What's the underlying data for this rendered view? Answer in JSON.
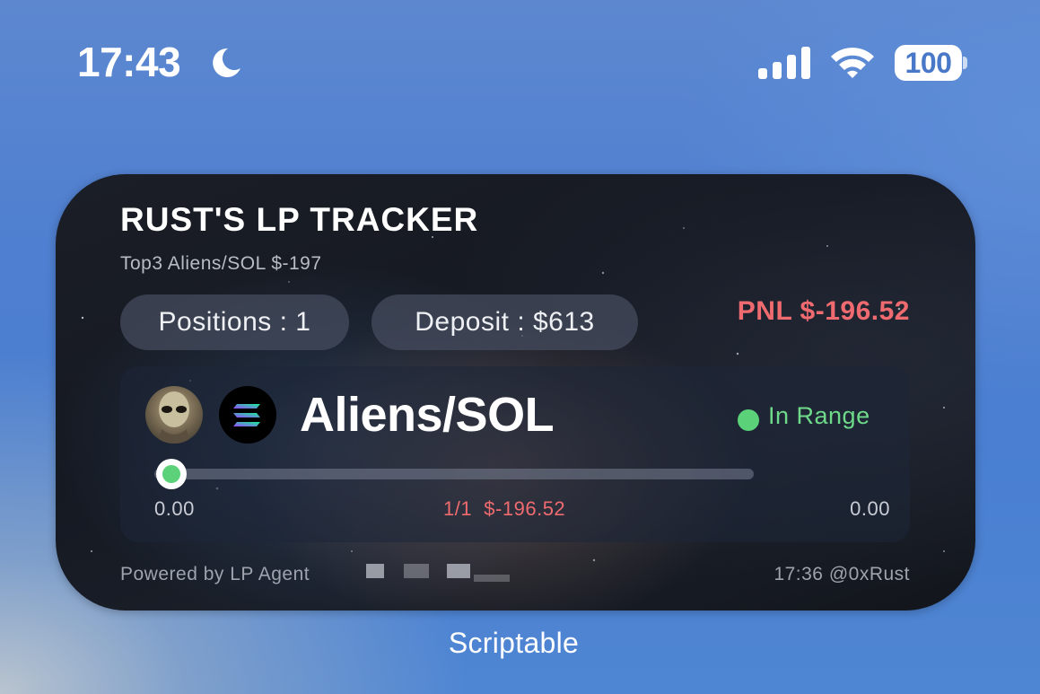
{
  "status_bar": {
    "time": "17:43",
    "focus_icon": "moon-icon",
    "signal_icon": "cellular-signal-icon",
    "wifi_icon": "wifi-icon",
    "battery_level": "100"
  },
  "widget": {
    "title": "RUST'S LP TRACKER",
    "subtitle": "Top3 Aliens/SOL $-197",
    "positions_label": "Positions : 1",
    "deposit_label": "Deposit : $613",
    "pnl_label": "PNL $-196.52",
    "pnl_color": "#ef6b6f",
    "position": {
      "pair": "Aliens/SOL",
      "token_a_icon": "alien-token-icon",
      "token_b_icon": "solana-token-icon",
      "status": "In Range",
      "status_color": "#5bd27a",
      "range_min": "0.00",
      "range_max": "0.00",
      "range_summary": "1/1  $-196.52",
      "current_price_position": 0.02
    },
    "footer_left": "Powered by LP Agent",
    "footer_right": "17:36  @0xRust"
  },
  "caption": "Scriptable"
}
